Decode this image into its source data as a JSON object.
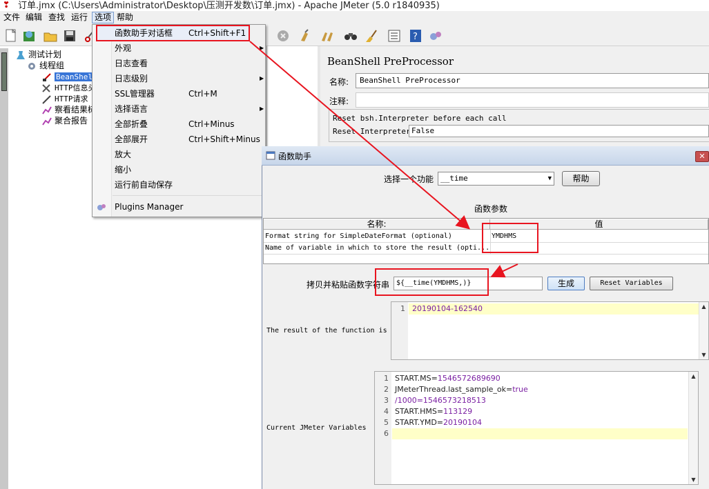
{
  "window": {
    "title": "订单.jmx (C:\\Users\\Administrator\\Desktop\\压测开发数\\订单.jmx) - Apache JMeter (5.0 r1840935)"
  },
  "menubar": [
    "文件",
    "编辑",
    "查找",
    "运行",
    "选项",
    "帮助"
  ],
  "tree": {
    "root": "测试计划",
    "thread_group": "线程组",
    "items": [
      "BeanShell",
      "HTTP信息头",
      "HTTP请求",
      "察看结果树",
      "聚合报告"
    ]
  },
  "options_menu": {
    "items": [
      {
        "label": "函数助手对话框",
        "shortcut": "Ctrl+Shift+F1"
      },
      {
        "label": "外观",
        "submenu": true
      },
      {
        "label": "日志查看"
      },
      {
        "label": "日志级别",
        "submenu": true
      },
      {
        "label": "SSL管理器",
        "shortcut": "Ctrl+M"
      },
      {
        "label": "选择语言",
        "submenu": true
      },
      {
        "label": "全部折叠",
        "shortcut": "Ctrl+Minus"
      },
      {
        "label": "全部展开",
        "shortcut": "Ctrl+Shift+Minus"
      },
      {
        "label": "放大"
      },
      {
        "label": "缩小"
      },
      {
        "label": "运行前自动保存"
      },
      {
        "label": "Plugins Manager"
      }
    ]
  },
  "beanshell_panel": {
    "title": "BeanShell PreProcessor",
    "name_label": "名称:",
    "name_value": "BeanShell PreProcessor",
    "comment_label": "注释:",
    "group_title": "Reset bsh.Interpreter before each call",
    "reset_label": "Reset Interpreter:",
    "reset_value": "False"
  },
  "dialog": {
    "title": "函数助手",
    "choose_label": "选择一个功能",
    "function": "__time",
    "help_button": "帮助",
    "params_heading": "函数参数",
    "table_headers": [
      "名称:",
      "值"
    ],
    "params": [
      {
        "name": "Format string for SimpleDateFormat (optional)",
        "value": "YMDHMS"
      },
      {
        "name": "Name of variable in which to store the result (opti...",
        "value": ""
      }
    ],
    "copy_label": "拷贝并粘贴函数字符串",
    "copy_value": "${__time(YMDHMS,)}",
    "generate_button": "生成",
    "reset_button": "Reset Variables",
    "result_label": "The result of the function is",
    "result_lines": [
      "20190104-162540"
    ],
    "vars_label": "Current JMeter Variables",
    "vars_lines": [
      {
        "key": "START.MS=",
        "val": "1546572689690"
      },
      {
        "key": "JMeterThread.last_sample_ok=",
        "val": "true"
      },
      {
        "key": "",
        "val": "/1000=1546573218513"
      },
      {
        "key": "START.HMS=",
        "val": "113129"
      },
      {
        "key": "START.YMD=",
        "val": "20190104"
      },
      {
        "key": "",
        "val": ""
      }
    ]
  },
  "colors": {
    "highlight_red": "#e8141f",
    "selection_blue": "#3875d7",
    "code_value": "#7a1fa2",
    "current_line": "#ffffc8"
  }
}
